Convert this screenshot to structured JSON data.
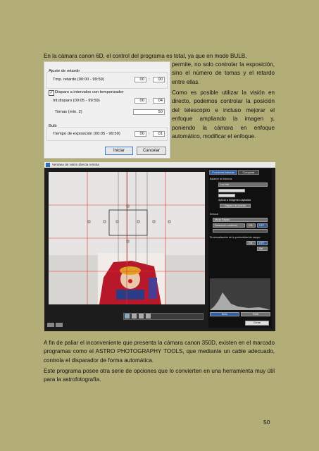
{
  "paragraphs": {
    "p1": "En la cámara canon 6D, el control del programa es total, ya que en modo BULB,",
    "p2": "permite, no solo controlar la exposición, sino el número de tomas y el retardo entre ellas.",
    "p3": "Como es posible utilizar la visión en directo, podemos controlar la posición del telescopio e incluso mejorar el enfoque ampliando la imagen y, poniendo la cámara en enfoque automático, modificar el enfoque.",
    "p4": "A fin de paliar el inconveniente que presenta la cámara canon 350D, existen en el marcado programas como el ASTRO PHOTOGRAPHY TOOLS, que mediante un cable adecuado, controla el disparador de forma automática.",
    "p5": "Este programa posee otra serie de opciones que lo convierten en una herramienta muy útil para la astrofotografía.",
    "page_number": "50"
  },
  "dialog": {
    "group1_title": "Ajuste de retardo",
    "delay_label": "Tmp. retardo (00:00 - 99:59)",
    "delay_min": "00",
    "delay_sec": "00",
    "interval_checkbox": "Disparo a intervalos con temporizador",
    "interval_label": "Int.disparo (00:05 - 99:59)",
    "interval_min": "00",
    "interval_sec": "04",
    "shots_label": "Tomas (mín. 2)",
    "shots_value": "50",
    "group2_title": "Bulb",
    "exposure_label": "Tiempo de exposición (00:05 - 99:59)",
    "exposure_min": "00",
    "exposure_sec": "01",
    "colon": ":",
    "check_mark": "✓",
    "start_button": "Iniciar",
    "cancel_button": "Cancelar"
  },
  "liveview": {
    "title": "Ventana de visión directa remota",
    "tab1": "Funciones básicas",
    "tab2": "Comparar",
    "wb_title": "Balance de blancos",
    "wb_value": "Luz día",
    "apply_label": "Aplicar a imágenes captadas",
    "test_shot": "Disparo de prueba",
    "af_title": "Enfocar",
    "af_mode": "Modo Rápido",
    "af_select": "Detección cuidando",
    "on": "ON",
    "off": "OFF",
    "dof_title": "Previsualización de la profundidad de campo",
    "dof_on": "ON",
    "dof_off": "OFF",
    "set": "Set",
    "histo_btn1": "Brillo",
    "histo_btn2": "RGB",
    "close_btn": "Cerrar"
  }
}
